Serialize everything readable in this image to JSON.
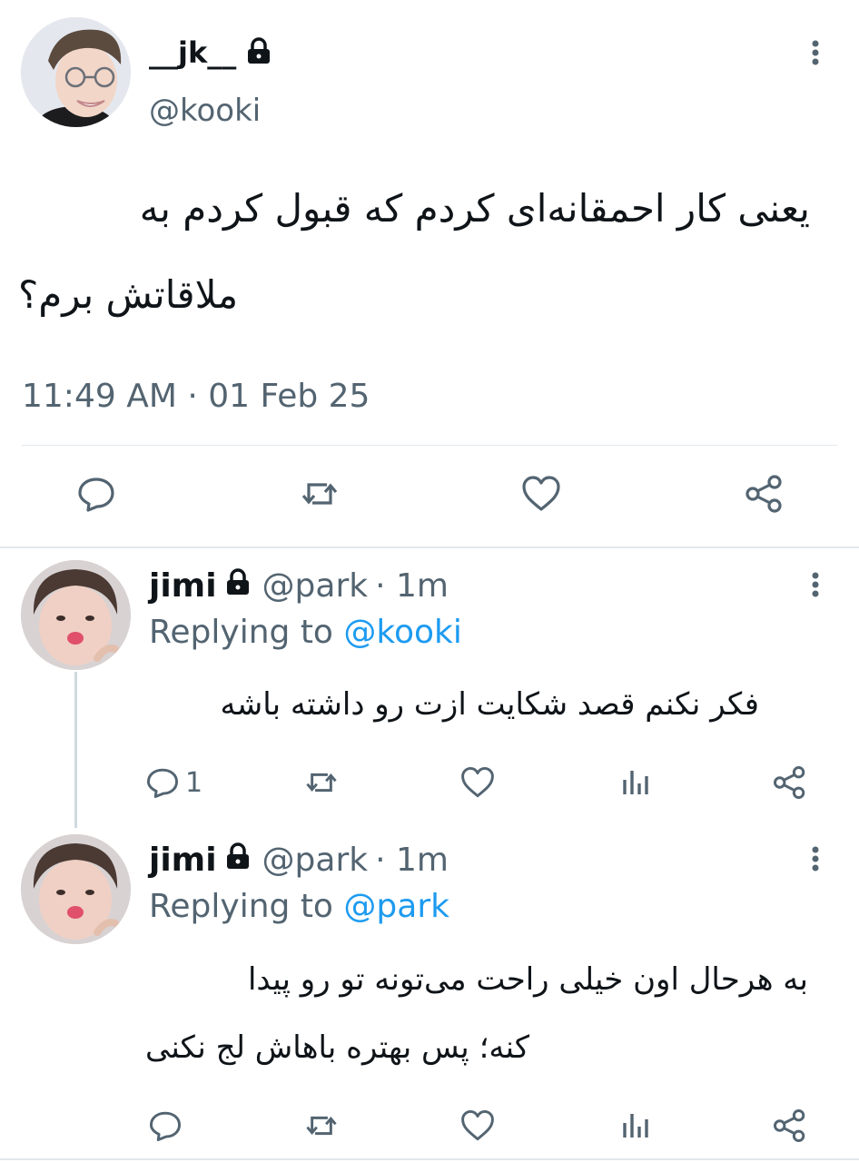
{
  "main_tweet": {
    "display_name": "__jk__",
    "handle": "@kooki",
    "text_line1": "یعنی کار احمقانه‌ای کردم که قبول کردم به",
    "text_line2": "ملاقاتش برم؟",
    "timestamp": "11:49 AM · 01 Feb 25",
    "actions": [
      "reply-icon",
      "retweet-icon",
      "like-icon",
      "share-icon"
    ]
  },
  "replies": [
    {
      "display_name": "jimi",
      "handle": "@park",
      "time": "· 1m",
      "replying_prefix": "Replying to",
      "replying_to": "@kooki",
      "text_line1": "فکر نکنم قصد شکایت ازت رو داشته باشه",
      "reply_count": "1"
    },
    {
      "display_name": "jimi",
      "handle": "@park",
      "time": "· 1m",
      "replying_prefix": "Replying to",
      "replying_to": "@park",
      "text_line1": "به هرحال اون خیلی راحت می‌تونه تو رو پیدا",
      "text_line2": "کنه؛ پس بهتره باهاش لج نکنی",
      "reply_count": ""
    }
  ],
  "colors": {
    "text": "#0f1419",
    "secondary": "#536471",
    "link": "#1d9bf0",
    "divider": "#e1e8ed"
  }
}
